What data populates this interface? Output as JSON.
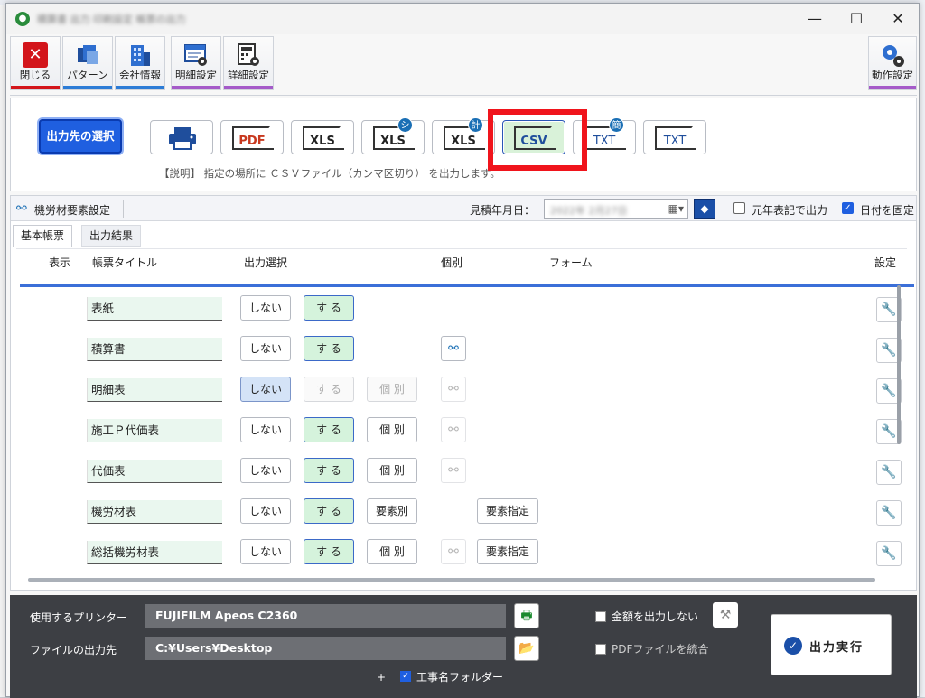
{
  "window": {
    "title": "積算書 出力 印刷設定 帳票の出力",
    "controls": {
      "minimize": "—",
      "maximize": "☐",
      "close": "✕"
    }
  },
  "toolbar": {
    "items": [
      {
        "label": "閉じる",
        "icon": "close-icon",
        "bar_color": "#d3151b"
      },
      {
        "label": "パターン",
        "icon": "folders-icon",
        "bar_color": "#2b7bd6"
      },
      {
        "label": "会社情報",
        "icon": "building-icon",
        "bar_color": "#2b7bd6"
      },
      {
        "label": "明細設定",
        "icon": "form-gear-icon",
        "bar_color": "#a45ac9"
      },
      {
        "label": "詳細設定",
        "icon": "calc-gear-icon",
        "bar_color": "#a45ac9"
      },
      {
        "label": "動作設定",
        "icon": "gears-icon",
        "bar_color": "#a45ac9"
      }
    ]
  },
  "output_formats": {
    "destination_button": "出力先の選択",
    "buttons": [
      {
        "label": "",
        "icon": "printer-icon",
        "badge": ""
      },
      {
        "label": "PDF",
        "icon": "pdf-icon",
        "badge": ""
      },
      {
        "label": "XLS",
        "icon": "xls-icon",
        "badge": ""
      },
      {
        "label": "XLS",
        "icon": "xls-shi-icon",
        "badge": "シ"
      },
      {
        "label": "XLS",
        "icon": "xls-kei-icon",
        "badge": "計"
      },
      {
        "label": "CSV",
        "icon": "csv-icon",
        "badge": "",
        "selected": true
      },
      {
        "label": "TXT",
        "icon": "txt-kan-icon",
        "badge": "簡"
      },
      {
        "label": "TXT",
        "icon": "txt-icon",
        "badge": ""
      }
    ],
    "description": "【説明】 指定の場所に ＣＳＶファイル（カンマ区切り） を出力します。"
  },
  "panel": {
    "header_label": "機労材要素設定",
    "date_label": "見積年月日：",
    "date_value": "2022年 2月27日",
    "gengo_label": "元年表記で出力",
    "gengo_checked": false,
    "fix_date_label": "日付を固定",
    "fix_date_checked": true
  },
  "tabs": [
    {
      "label": "基本帳票",
      "active": true
    },
    {
      "label": "出力結果",
      "active": false
    }
  ],
  "columns": {
    "show": "表示",
    "title": "帳票タイトル",
    "output": "出力選択",
    "individual": "個別",
    "form": "フォーム",
    "settings": "設定"
  },
  "rows": [
    {
      "title": "表紙",
      "no_label": "しない",
      "yes_label": "す る",
      "state": "yes",
      "detail": "",
      "tree": "none",
      "element": ""
    },
    {
      "title": "積算書",
      "no_label": "しない",
      "yes_label": "す る",
      "state": "yes",
      "detail": "",
      "tree": "active",
      "element": ""
    },
    {
      "title": "明細表",
      "no_label": "しない",
      "yes_label": "す る",
      "state": "no",
      "detail": "個 別",
      "tree": "disabled",
      "element": ""
    },
    {
      "title": "施工Ｐ代価表",
      "no_label": "しない",
      "yes_label": "す る",
      "state": "yes",
      "detail": "個 別",
      "tree": "disabled",
      "element": ""
    },
    {
      "title": "代価表",
      "no_label": "しない",
      "yes_label": "す る",
      "state": "yes",
      "detail": "個 別",
      "tree": "disabled",
      "element": ""
    },
    {
      "title": "機労材表",
      "no_label": "しない",
      "yes_label": "す る",
      "state": "yes",
      "detail": "要素別",
      "tree": "none",
      "element": "要素指定"
    },
    {
      "title": "総括機労材表",
      "no_label": "しない",
      "yes_label": "す る",
      "state": "yes",
      "detail": "個 別",
      "tree": "disabled",
      "element": "要素指定"
    }
  ],
  "footer": {
    "printer_label": "使用するプリンター",
    "printer_value": "FUJIFILM Apeos C2360",
    "path_label": "ファイルの出力先",
    "path_value": "C:¥Users¥Desktop",
    "plus": "+",
    "project_folder_label": "工事名フォルダー",
    "project_folder_checked": true,
    "no_amount_label": "金額を出力しない",
    "no_amount_checked": false,
    "merge_pdf_label": "PDFファイルを統合",
    "merge_pdf_checked": false,
    "execute_label": "出力実行"
  }
}
